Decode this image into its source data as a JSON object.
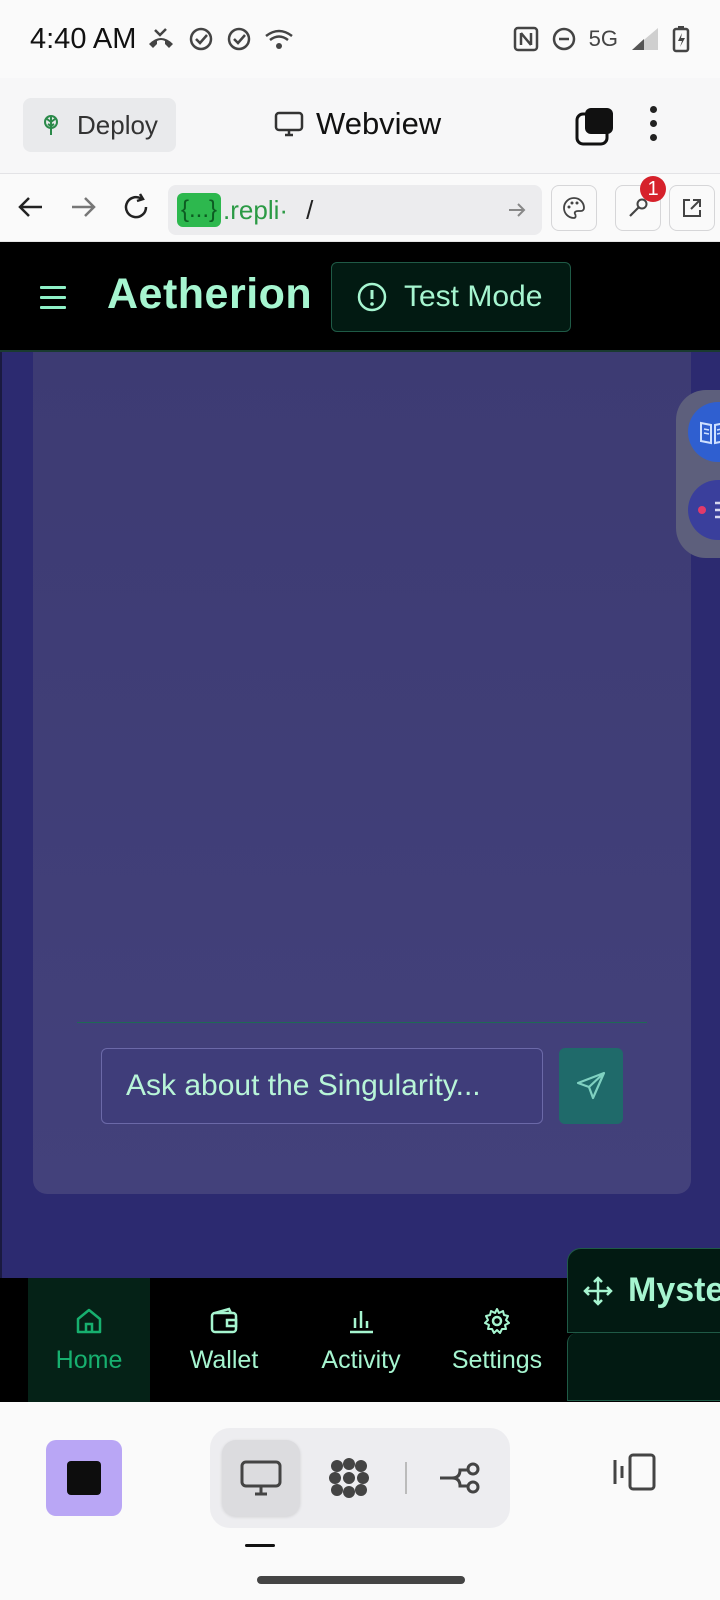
{
  "status_bar": {
    "time": "4:40 AM",
    "network": "5G"
  },
  "replit": {
    "deploy_label": "Deploy",
    "webview_label": "Webview",
    "url_badge": "{...}",
    "url_host": ".repli·",
    "url_path": "/",
    "notification_count": "1"
  },
  "app": {
    "title": "Aetherion",
    "test_mode_label": "Test Mode",
    "chat": {
      "input_placeholder": "Ask about the Singularity..."
    },
    "nav": [
      {
        "label": "Home",
        "icon": "home-icon",
        "active": true
      },
      {
        "label": "Wallet",
        "icon": "wallet-icon",
        "active": false
      },
      {
        "label": "Activity",
        "icon": "bar-chart-icon",
        "active": false
      },
      {
        "label": "Settings",
        "icon": "gear-icon",
        "active": false
      }
    ],
    "mystery_label": "Myste"
  },
  "colors": {
    "accent_mint": "#a6f5d0",
    "active_green": "#17b06f",
    "panel_purple": "#3d3b73",
    "body_indigo": "#2c2a70",
    "stop_button": "#b9a6f5"
  }
}
